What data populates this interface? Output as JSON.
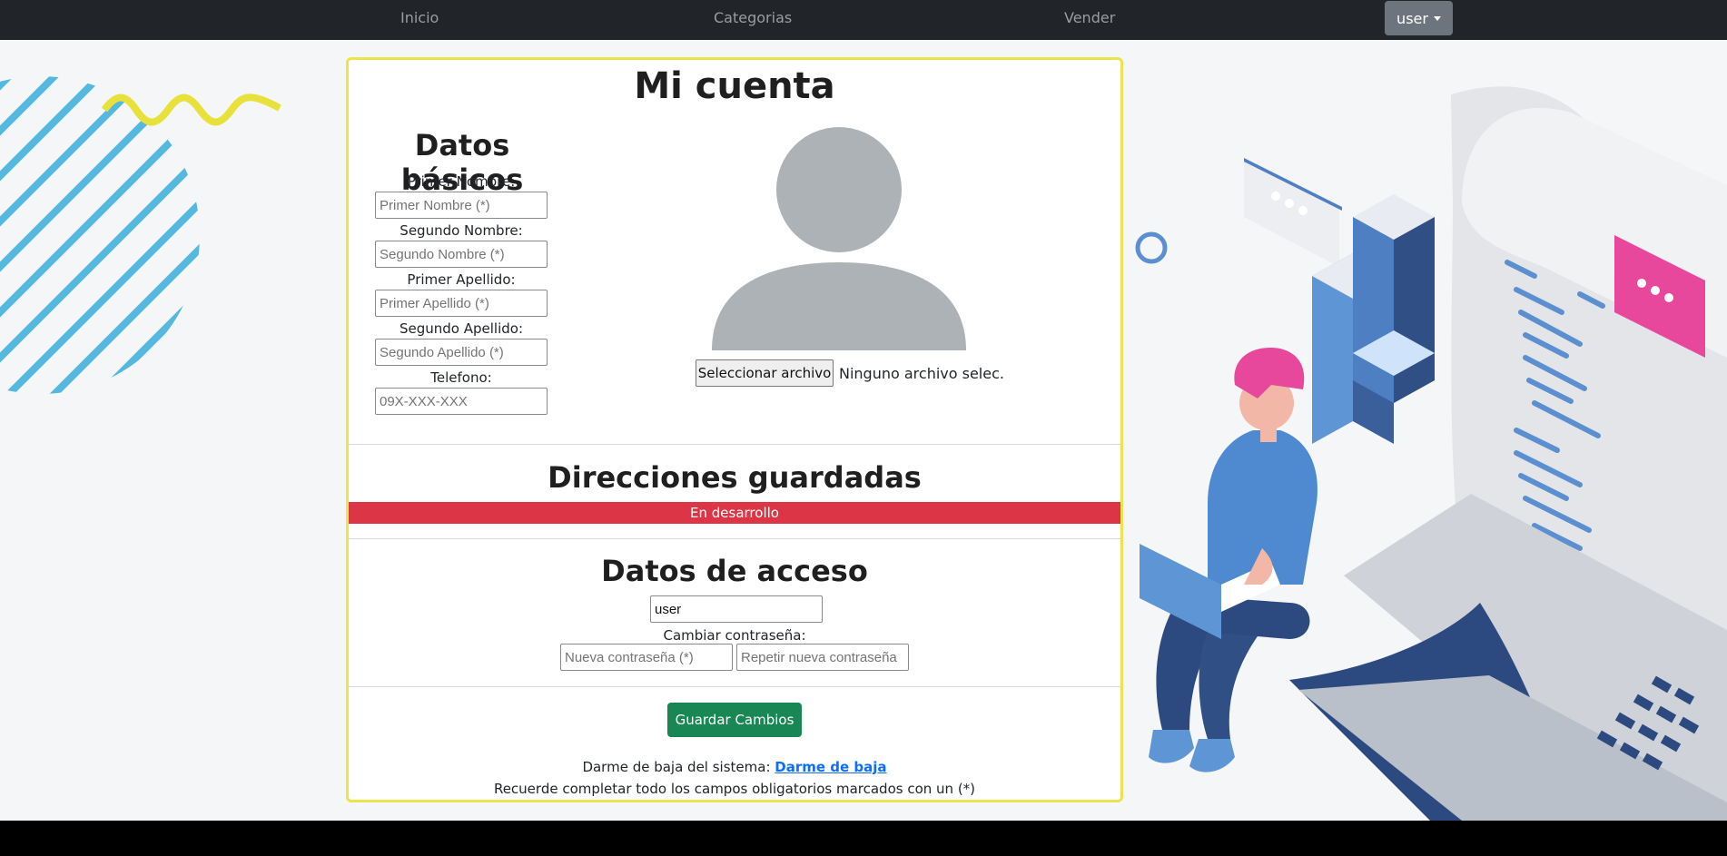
{
  "nav": {
    "links": [
      "Inicio",
      "Categorias",
      "Vender"
    ],
    "user_menu": "user"
  },
  "account": {
    "title": "Mi cuenta",
    "basic": {
      "title": "Datos básicos",
      "fields": [
        {
          "label": "Primer Nombre:",
          "placeholder": "Primer Nombre (*)"
        },
        {
          "label": "Segundo Nombre:",
          "placeholder": "Segundo Nombre (*)"
        },
        {
          "label": "Primer Apellido:",
          "placeholder": "Primer Apellido (*)"
        },
        {
          "label": "Segundo Apellido:",
          "placeholder": "Segundo Apellido (*)"
        },
        {
          "label": "Telefono:",
          "placeholder": "09X-XXX-XXX"
        }
      ]
    },
    "photo": {
      "button": "Seleccionar archivo",
      "status": "Ninguno archivo selec."
    },
    "addresses": {
      "title": "Direcciones guardadas",
      "alert": "En desarrollo"
    },
    "access": {
      "title": "Datos de acceso",
      "username": "user",
      "change_label": "Cambiar contraseña:",
      "new_password_placeholder": "Nueva contraseña (*)",
      "repeat_password_placeholder": "Repetir nueva contraseña"
    },
    "save_button": "Guardar Cambios",
    "unsubscribe": {
      "text": "Darme de baja del sistema:",
      "link": "Darme de baja"
    },
    "reminder": "Recuerde completar todo los campos obligatorios marcados con un (*)"
  },
  "colors": {
    "navbar": "#212529",
    "card_border": "#ede34c",
    "alert": "#dc3545",
    "save": "#198754",
    "link": "#0d6efd"
  }
}
